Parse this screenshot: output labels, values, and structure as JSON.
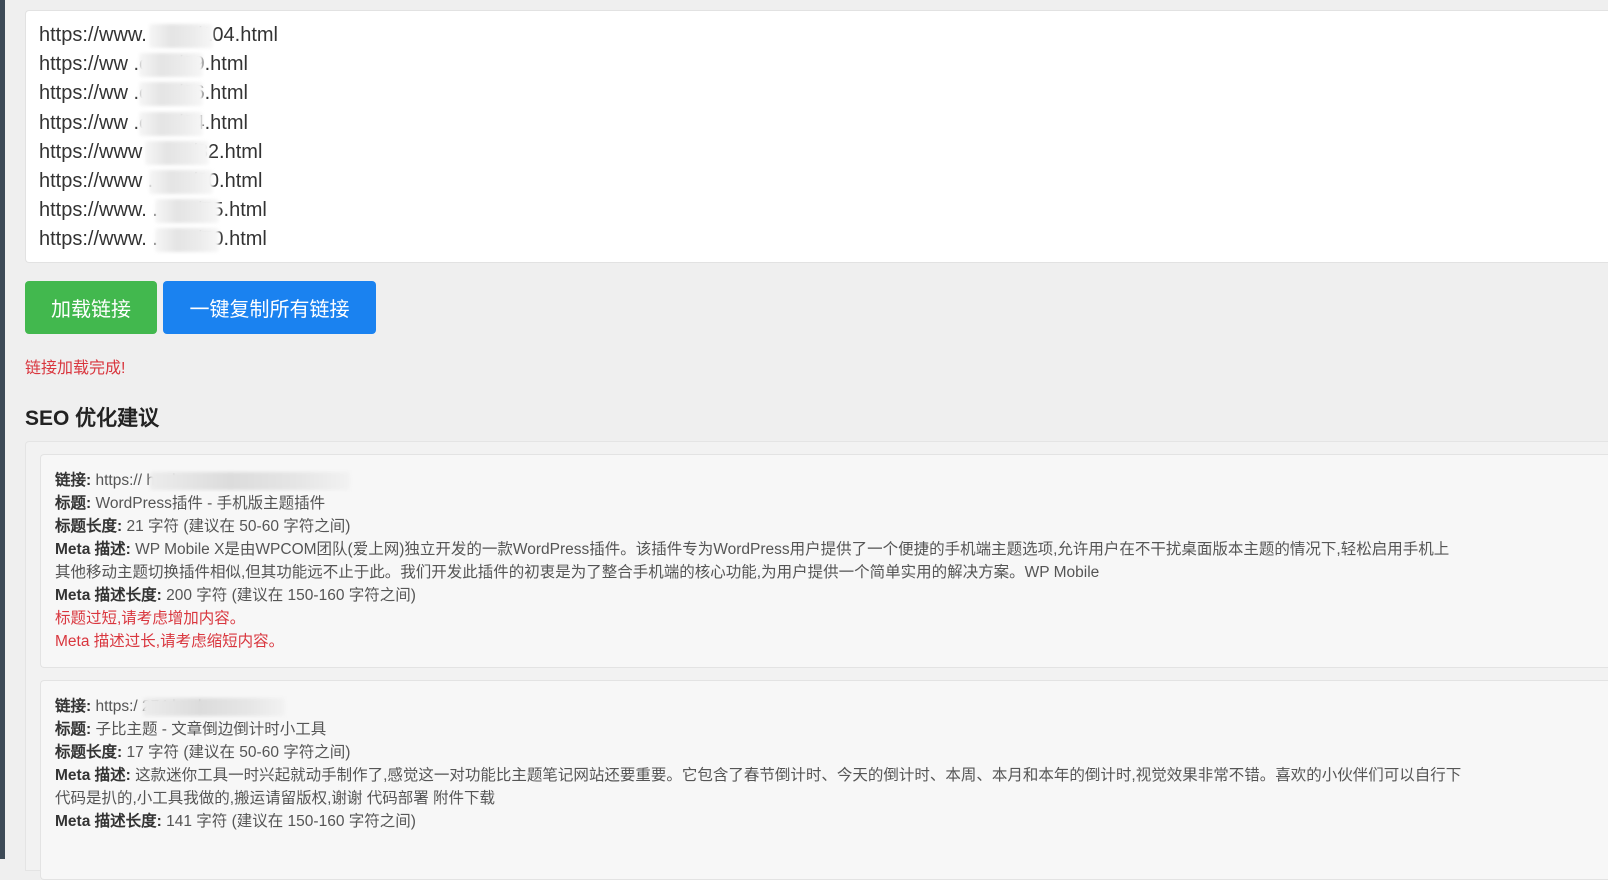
{
  "url_list": [
    "https://www.        .com/104.html",
    "https://ww         .com/99.html",
    "https://ww         .com/96.html",
    "https://ww        .com/94.html",
    "https://www        .com/82.html",
    "https://www        .com/80.html",
    "https://www.       .com/75.html",
    "https://www.       .com/70.html"
  ],
  "buttons": {
    "load_label": "加载链接",
    "copy_all_label": "一键复制所有链接"
  },
  "status_message": "链接加载完成!",
  "seo_section": {
    "title": "SEO 优化建议",
    "results": [
      {
        "link_label": "链接:",
        "link_value": "https://                    html",
        "title_label": "标题:",
        "title_value": "WordPress插件 - 手机版主题插件",
        "title_length_label": "标题长度:",
        "title_length_value": "21 字符 (建议在 50-60 字符之间)",
        "meta_desc_label": "Meta 描述:",
        "meta_desc_value": "WP Mobile X是由WPCOM团队(爱上网)独立开发的一款WordPress插件。该插件专为WordPress用户提供了一个便捷的手机端主题选项,允许用户在不干扰桌面版本主题的情况下,轻松启用手机上",
        "meta_desc_value_2": "其他移动主题切换插件相似,但其功能远不止于此。我们开发此插件的初衷是为了整合手机端的核心功能,为用户提供一个简单实用的解决方案。WP Mobile",
        "meta_length_label": "Meta 描述长度:",
        "meta_length_value": "200 字符 (建议在 150-160 字符之间)",
        "warnings": [
          "标题过短,请考虑增加内容。",
          "Meta 描述过长,请考虑缩短内容。"
        ]
      },
      {
        "link_label": "链接:",
        "link_value": "https:/                    274.html",
        "title_label": "标题:",
        "title_value": "子比主题 - 文章倒边倒计时小工具",
        "title_length_label": "标题长度:",
        "title_length_value": "17 字符 (建议在 50-60 字符之间)",
        "meta_desc_label": "Meta 描述:",
        "meta_desc_value": "这款迷你工具一时兴起就动手制作了,感觉这一对功能比主题笔记网站还要重要。它包含了春节倒计时、今天的倒计时、本周、本月和本年的倒计时,视觉效果非常不错。喜欢的小伙伴们可以自行下",
        "meta_desc_value_2": "代码是扒的,小工具我做的,搬运请留版权,谢谢 代码部署 附件下载",
        "meta_length_label": "Meta 描述长度:",
        "meta_length_value": "141 字符 (建议在 150-160 字符之间)"
      }
    ]
  },
  "colors": {
    "load_button": "#42b84e",
    "copy_button": "#1a82f0",
    "warning_text": "#d9363e"
  }
}
